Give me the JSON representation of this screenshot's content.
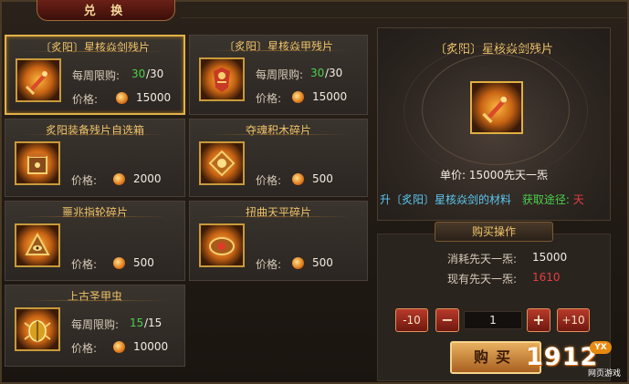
{
  "window": {
    "title": "兑 换"
  },
  "labels": {
    "weekly_limit": "每周限购:",
    "price": "价格:"
  },
  "items": [
    {
      "name": "〔炙阳〕星核焱剑残片",
      "limit_used": "30",
      "limit_total": "/30",
      "price": "15000",
      "icon": "sword-fragment-icon",
      "selected": true
    },
    {
      "name": "〔炙阳〕星核焱甲残片",
      "limit_used": "30",
      "limit_total": "/30",
      "price": "15000",
      "icon": "armor-fragment-icon",
      "selected": false
    },
    {
      "name": "炙阳装备残片自选箱",
      "price": "2000",
      "icon": "equipment-box-icon"
    },
    {
      "name": "夺魂积木碎片",
      "price": "500",
      "icon": "soul-block-icon"
    },
    {
      "name": "噩兆指轮碎片",
      "price": "500",
      "icon": "omen-ring-icon"
    },
    {
      "name": "扭曲天平碎片",
      "price": "500",
      "icon": "twisted-scale-icon"
    },
    {
      "name": "上古圣甲虫",
      "limit_used": "15",
      "limit_total": "/15",
      "price": "10000",
      "icon": "scarab-icon"
    }
  ],
  "preview": {
    "title": "〔炙阳〕星核焱剑残片",
    "unit_price": "单价: 15000先天一炁",
    "material_text": "升〔炙阳〕星核焱剑的材料",
    "source_label": "获取途径:",
    "source_value": "天"
  },
  "purchase": {
    "section_title": "购买操作",
    "cost_label": "消耗先天一炁:",
    "cost_value": "15000",
    "owned_label": "现有先天一炁:",
    "owned_value": "1610",
    "minus10_label": "-10",
    "minus_label": "−",
    "quantity": "1",
    "plus_label": "+",
    "plus10_label": "+10",
    "buy_label": "购买"
  },
  "watermark": {
    "number": "1912",
    "badge": "YX",
    "subtitle": "网页游戏"
  },
  "colors": {
    "gold_text": "#f0c46a",
    "limit_green": "#4cd04c",
    "owned_red": "#e04040",
    "material_cyan": "#5ac8f0",
    "selected_border": "#e2b14a"
  }
}
